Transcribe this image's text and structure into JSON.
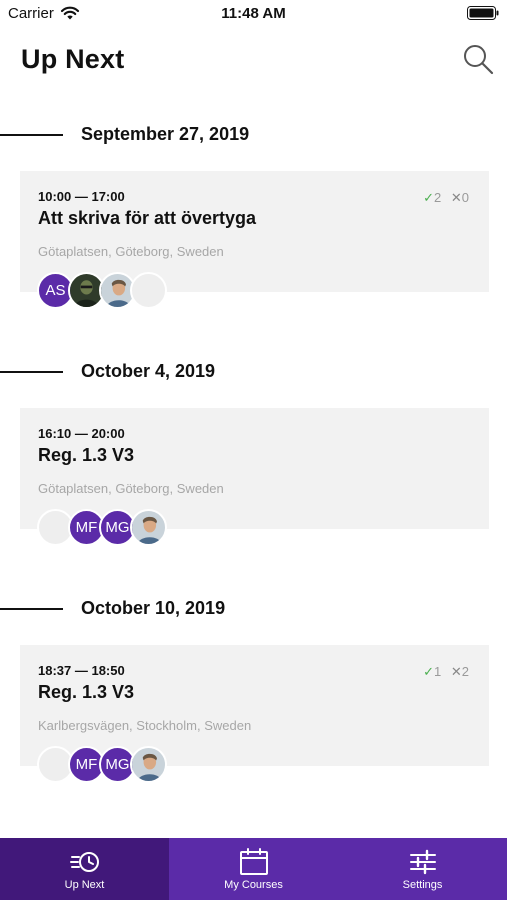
{
  "status_bar": {
    "carrier": "Carrier",
    "time": "11:48 AM"
  },
  "header": {
    "title": "Up Next",
    "search_icon": "search-icon"
  },
  "sections": [
    {
      "date": "September 27, 2019",
      "event": {
        "time": "10:00 — 17:00",
        "title": "Att skriva för att övertyga",
        "location": "Götaplatsen, Göteborg, Sweden",
        "accepted": "2",
        "declined": "0",
        "attendees": [
          {
            "type": "initials",
            "text": "AS"
          },
          {
            "type": "photo",
            "icon": "person-photo-dark"
          },
          {
            "type": "photo",
            "icon": "person-photo-light"
          },
          {
            "type": "empty"
          }
        ]
      }
    },
    {
      "date": "October 4, 2019",
      "event": {
        "time": "16:10 — 20:00",
        "title": "Reg. 1.3 V3",
        "location": "Götaplatsen, Göteborg, Sweden",
        "attendees": [
          {
            "type": "empty"
          },
          {
            "type": "initials",
            "text": "MF"
          },
          {
            "type": "initials",
            "text": "MG"
          },
          {
            "type": "photo",
            "icon": "person-photo-light"
          }
        ]
      }
    },
    {
      "date": "October 10, 2019",
      "event": {
        "time": "18:37 — 18:50",
        "title": "Reg. 1.3 V3",
        "location": "Karlbergsvägen, Stockholm, Sweden",
        "accepted": "1",
        "declined": "2",
        "attendees": [
          {
            "type": "empty"
          },
          {
            "type": "initials",
            "text": "MF"
          },
          {
            "type": "initials",
            "text": "MG"
          },
          {
            "type": "photo",
            "icon": "person-photo-light"
          }
        ]
      }
    }
  ],
  "tabs": [
    {
      "label": "Up Next",
      "icon": "history-icon",
      "active": true
    },
    {
      "label": "My Courses",
      "icon": "calendar-icon",
      "active": false
    },
    {
      "label": "Settings",
      "icon": "sliders-icon",
      "active": false
    }
  ],
  "colors": {
    "accent": "#5b2ba8",
    "accent_dark": "#41187a",
    "card": "#f2f2f2",
    "check": "#4caf50"
  }
}
